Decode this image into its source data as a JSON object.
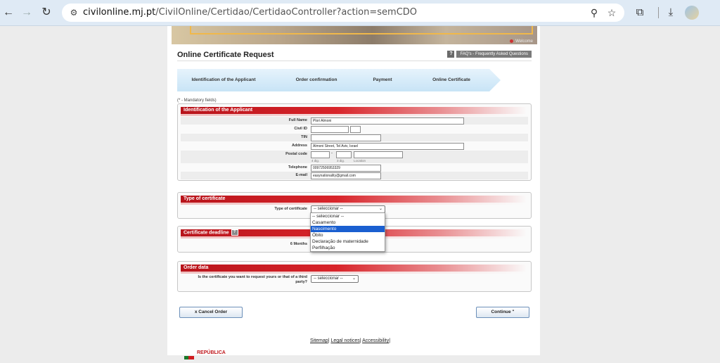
{
  "browser": {
    "url_host": "civilonline.mj.pt",
    "url_path": "/CivilOnline/Certidao/CertidaoController?action=semCDO"
  },
  "banner": {
    "welcome": "Welcome"
  },
  "page": {
    "title": "Online Certificate Request",
    "faq_icon": "?",
    "faq_label": "FAQ's - Frequently Asked Questions",
    "mandatory_note": "(* - Mandatory fields)"
  },
  "steps": [
    "Identification of the Applicant",
    "Order confirmation",
    "Payment",
    "Online Certificate"
  ],
  "identification": {
    "title": "Identification of the Applicant",
    "full_name_label": "Full Name",
    "full_name_value": "Plori Almoni",
    "civil_id_label": "Civil ID",
    "tin_label": "TIN",
    "address_label": "Address",
    "address_value": "Almoni Street, Tel Aviv, Israel",
    "postal_code_label": "Postal code",
    "postal_dash": "-",
    "hint_4dig": "4 dig.",
    "hint_3dig": "3 dig.",
    "hint_location": "Location",
    "telephone_label": "Telephone",
    "telephone_value": "00972506953329",
    "email_label": "E-mail",
    "email_value": "easynationality@gmail.com"
  },
  "certificate_type": {
    "title": "Type of certificate",
    "label": "Type of certificate",
    "selected": "-- seleccionar --",
    "options": [
      "-- seleccionar --",
      "Casamento",
      "Nascimento",
      "Óbito",
      "Declaração de maternidade",
      "Perfilhação"
    ],
    "highlighted_index": 2
  },
  "deadline": {
    "title": "Certificate deadline",
    "help_icon": "?",
    "label": "6 Months"
  },
  "order": {
    "title": "Order data",
    "question_line1": "Is the certificate you want to request yours or that of a third",
    "question_line2": "party?",
    "selected": "-- seleccionar --"
  },
  "buttons": {
    "cancel": "x Cancel Order",
    "continue": "Continue \""
  },
  "footer": {
    "sitemap": "Sitemap",
    "legal": "Legal notices",
    "accessibility": "Accessibility",
    "separator": "|",
    "logo_text": "REPÚBLICA"
  }
}
